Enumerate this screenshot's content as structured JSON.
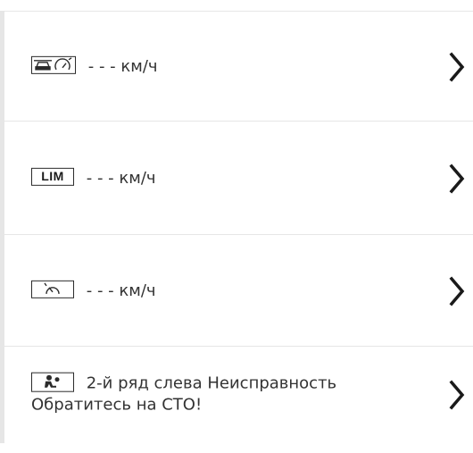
{
  "items": [
    {
      "icon": "adaptive-cruise-icon",
      "text": "- - - км/ч"
    },
    {
      "icon": "speed-limiter-icon",
      "icon_text": "LIM",
      "text": "- - - км/ч"
    },
    {
      "icon": "cruise-control-icon",
      "text": "- - - км/ч"
    },
    {
      "icon": "passenger-airbag-icon",
      "text": "2-й ряд слева Неисправность Обратитесь на СТО!"
    }
  ],
  "chevron_icon": "chevron-right-icon",
  "colors": {
    "separator": "#e6e6e6",
    "text": "#333333",
    "icon": "#2b2b2b"
  }
}
